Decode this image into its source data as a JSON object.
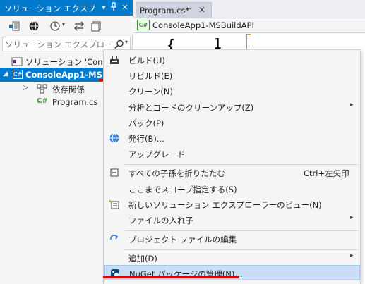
{
  "solution_explorer": {
    "title": "ソリューション エクスプロー...",
    "pin_glyph": "⊥",
    "close_glyph": "✕",
    "dropdown_glyph": "▾",
    "search_placeholder": "ソリューション エクスプローラー",
    "tree": [
      {
        "label": "ソリューション 'Console",
        "kind": "solution"
      },
      {
        "label": "ConsoleApp1-MS",
        "kind": "project",
        "selected": true,
        "icon_text": "C#"
      },
      {
        "label": "依存関係",
        "kind": "dependencies"
      },
      {
        "label": "Program.cs",
        "kind": "file",
        "icon_text": "C#"
      }
    ]
  },
  "editor": {
    "tab_label": "Program.cs*",
    "tab_pin": "⊣",
    "tab_close": "✕",
    "nav_project": "ConsoleApp1-MSBuildAPI",
    "nav_icon_text": "C#",
    "code_brace": "{",
    "code_number": "1"
  },
  "context_menu": {
    "items": [
      {
        "label": "ビルド(U)",
        "icon": "build-icon"
      },
      {
        "label": "リビルド(E)"
      },
      {
        "label": "クリーン(N)"
      },
      {
        "label": "分析とコードのクリーンアップ(Z)",
        "submenu": true
      },
      {
        "label": "パック(P)"
      },
      {
        "label": "発行(B)...",
        "icon": "publish-globe-icon"
      },
      {
        "label": "アップグレード"
      },
      {
        "label": "すべての子孫を折りたたむ",
        "shortcut": "Ctrl+左矢印",
        "icon": "collapse-all-icon"
      },
      {
        "label": "ここまでスコープ指定する(S)"
      },
      {
        "label": "新しいソリューション エクスプローラーのビュー(N)",
        "icon": "new-view-icon"
      },
      {
        "label": "ファイルの入れ子",
        "submenu": true
      },
      {
        "label": "プロジェクト ファイルの編集",
        "icon": "edit-project-icon"
      },
      {
        "label": "追加(D)",
        "submenu": true
      },
      {
        "label": "NuGet パッケージの管理(N)...",
        "icon": "nuget-icon",
        "highlighted": true
      }
    ],
    "submenu_arrow": "▸"
  },
  "colors": {
    "accent": "#007acc",
    "highlight": "#c9def5",
    "annotation_red": "#e00000"
  }
}
